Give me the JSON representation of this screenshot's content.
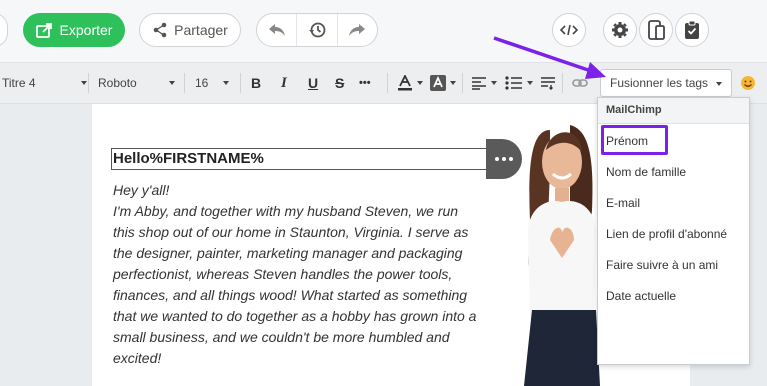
{
  "topbar": {
    "export_label": "Exporter",
    "share_label": "Partager"
  },
  "toolbar": {
    "style_select": "Titre 4",
    "font_select": "Roboto",
    "size_select": "16",
    "bold": "B",
    "italic": "I",
    "underline": "U",
    "strike": "S",
    "more": "•••",
    "merge_tags_label": "Fusionner les tags"
  },
  "merge_menu": {
    "header": "MailChimp",
    "items": [
      "Prénom",
      "Nom de famille",
      "E-mail",
      "Lien de profil d'abonné",
      "Faire suivre à un ami",
      "Date actuelle"
    ],
    "selected": "Prénom"
  },
  "content": {
    "heading": "Hello%FIRSTNAME%",
    "lines": [
      "Hey y'all!",
      "I'm Abby, and together with my husband Steven, we run",
      "this shop out of our home in Staunton, Virginia. I serve as",
      "the designer, painter, marketing manager and packaging",
      "perfectionist, whereas Steven handles the power tools,",
      "finances, and all things wood! What started as something",
      "that we wanted to do together as a hobby has grown into a",
      "small business, and we couldn't be more humbled and",
      "excited!"
    ]
  },
  "colors": {
    "export_green": "#2ec15b",
    "highlight_purple": "#7b21e8"
  }
}
